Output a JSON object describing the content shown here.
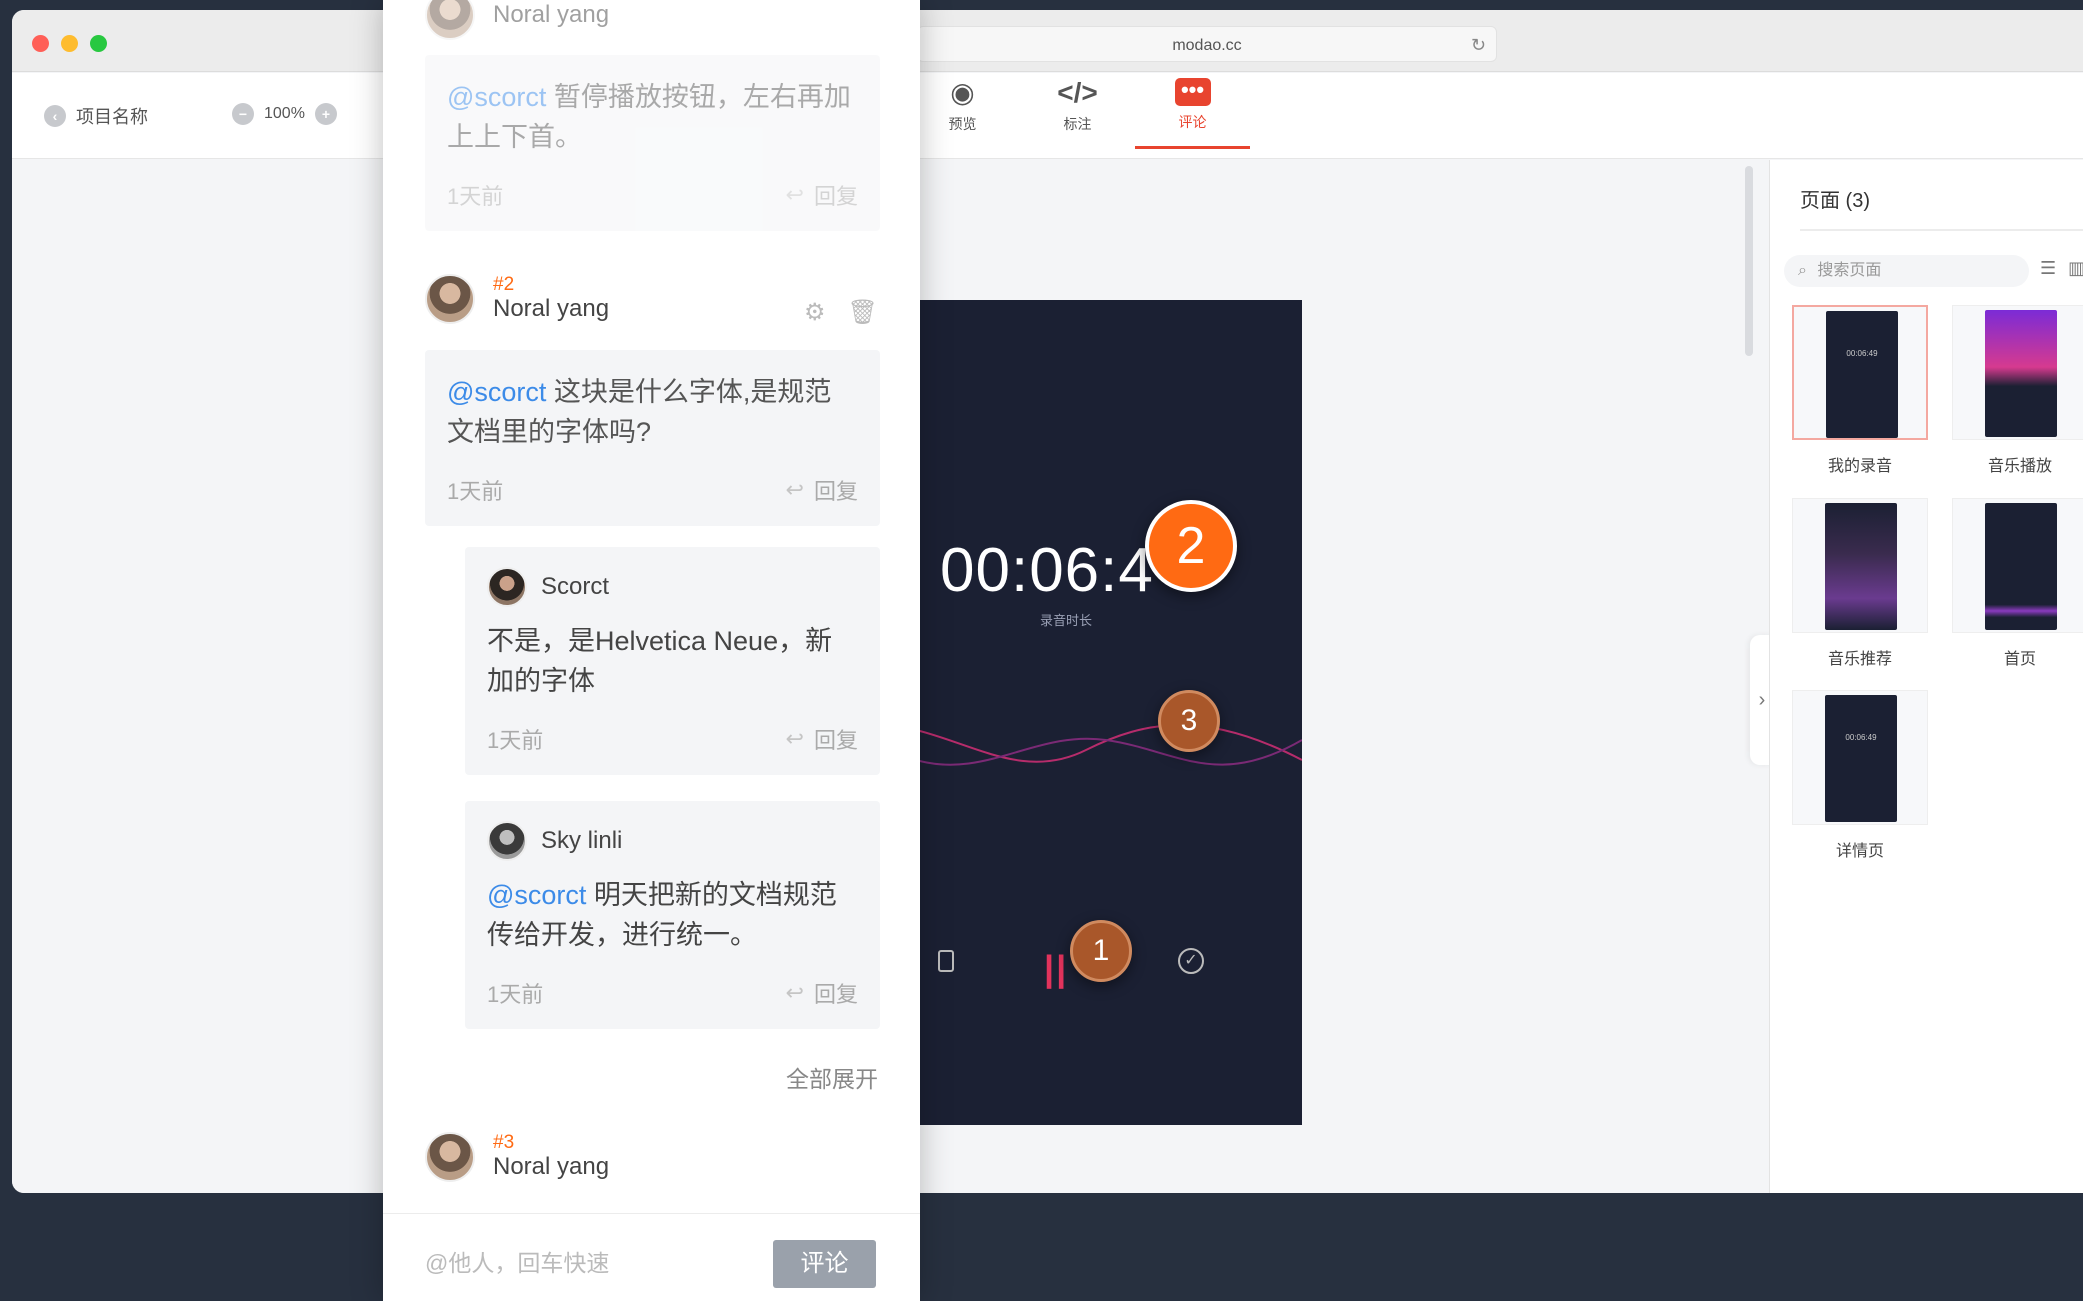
{
  "browser": {
    "url": "modao.cc"
  },
  "toolbar": {
    "project_name": "项目名称",
    "zoom": "100%",
    "tabs": [
      {
        "label": "预览",
        "icon": "eye-icon"
      },
      {
        "label": "标注",
        "icon": "code-icon"
      },
      {
        "label": "评论",
        "icon": "comment-icon",
        "active": true
      }
    ]
  },
  "artboard": {
    "timer": "00:06:4",
    "timer_sub": "录音时长",
    "pins": [
      "2",
      "3",
      "1"
    ]
  },
  "pages_panel": {
    "title": "页面 (3)",
    "search_placeholder": "搜索页面",
    "pages": [
      {
        "label": "我的录音",
        "mini": "00:06:49"
      },
      {
        "label": "音乐播放",
        "mini": ""
      },
      {
        "label": "音乐推荐",
        "mini": ""
      },
      {
        "label": "首页",
        "mini": ""
      },
      {
        "label": "详情页",
        "mini": "00:06:49"
      }
    ]
  },
  "comments": {
    "c1": {
      "name": "Noral yang",
      "mention": "@scorct",
      "text": " 暂停播放按钮，左右再加上上下首。",
      "time": "1天前",
      "reply": "回复"
    },
    "c2": {
      "num": "#2",
      "name": "Noral yang",
      "mention": "@scorct",
      "text": " 这块是什么字体,是规范文档里的字体吗?",
      "time": "1天前",
      "reply": "回复",
      "replies": [
        {
          "name": "Scorct",
          "mention": "",
          "text": "不是，是Helvetica Neue，新加的字体",
          "time": "1天前",
          "reply": "回复"
        },
        {
          "name": "Sky linli",
          "mention": "@scorct",
          "text": " 明天把新的文档规范传给开发，进行统一。",
          "time": "1天前",
          "reply": "回复"
        }
      ]
    },
    "expand_all": "全部展开",
    "c3": {
      "num": "#3",
      "name": "Noral yang"
    },
    "input_placeholder": "@他人，回车快速",
    "submit": "评论"
  }
}
